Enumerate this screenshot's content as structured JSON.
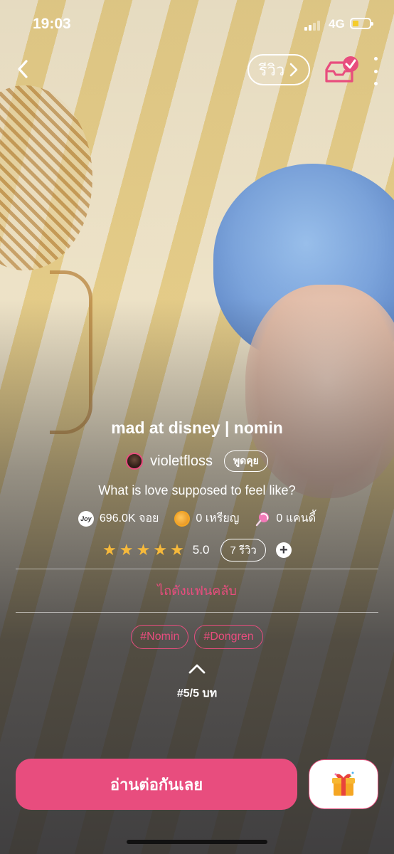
{
  "status": {
    "time": "19:03",
    "network": "4G"
  },
  "nav": {
    "review_label": "รีวิว"
  },
  "novel": {
    "title": "mad at disney | nomin",
    "author": "violetfloss",
    "chat_label": "พูดคุย",
    "tagline": "What is love supposed to feel like?",
    "stats": {
      "joy_icon": "Joy",
      "joy": "696.0K จอย",
      "coins": "0 เหรียญ",
      "candy": "0 แคนดี้"
    },
    "rating": {
      "stars": 5,
      "value": "5.0",
      "reviews_label": "7 รีวิว",
      "plus": "+"
    },
    "fanclub_label": "ไถดังแฟนคลับ",
    "tags": [
      "#Nomin",
      "#Dongren"
    ],
    "chapters": "#5/5 บท"
  },
  "actions": {
    "read_label": "อ่านต่อกันเลย"
  },
  "colors": {
    "accent": "#e84d7e",
    "star": "#f6b93b"
  }
}
